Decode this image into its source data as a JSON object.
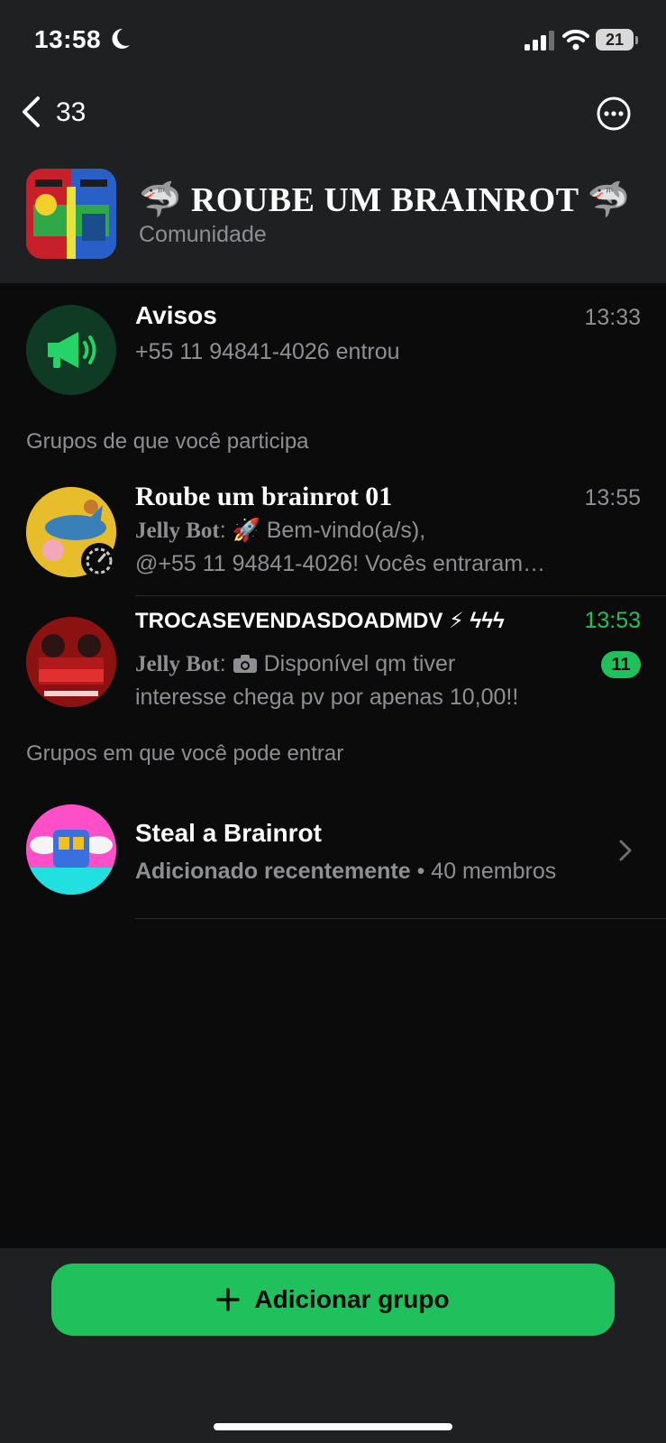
{
  "status_bar": {
    "time": "13:58",
    "battery": "21"
  },
  "nav": {
    "back_count": "33"
  },
  "community": {
    "title": "🦈 ROUBE UM BRAINROT 🦈",
    "subtitle": "Comunidade"
  },
  "announcements": {
    "name": "Avisos",
    "time": "13:33",
    "preview": "+55 11 94841-4026 entrou"
  },
  "section_joined": "Grupos de que você participa",
  "groups_joined": [
    {
      "name": "Roube um brainrot 01",
      "time": "13:55",
      "sender": "Jelly Bot",
      "line1": " 🚀 Bem-vindo(a/s),",
      "line2": "@+55 11 94841-4026! Vocês entraram…"
    },
    {
      "name": "TROCASEVENDASDOADMDV ⚡ ϟϟϟ",
      "time": "13:53",
      "sender": "Jelly Bot",
      "line1": " Disponível qm tiver",
      "line2": "interesse chega pv por apenas 10,00!!",
      "unread": "11"
    }
  ],
  "section_available": "Grupos em que você pode entrar",
  "groups_available": [
    {
      "name": "Steal a Brainrot",
      "detail": "Adicionado recentemente",
      "members": "40 membros"
    }
  ],
  "add_group_label": "Adicionar grupo",
  "colors": {
    "accent": "#20c05c",
    "header_bg": "#1f2021",
    "list_bg": "#0b0b0b",
    "secondary_text": "#8e8f92"
  }
}
